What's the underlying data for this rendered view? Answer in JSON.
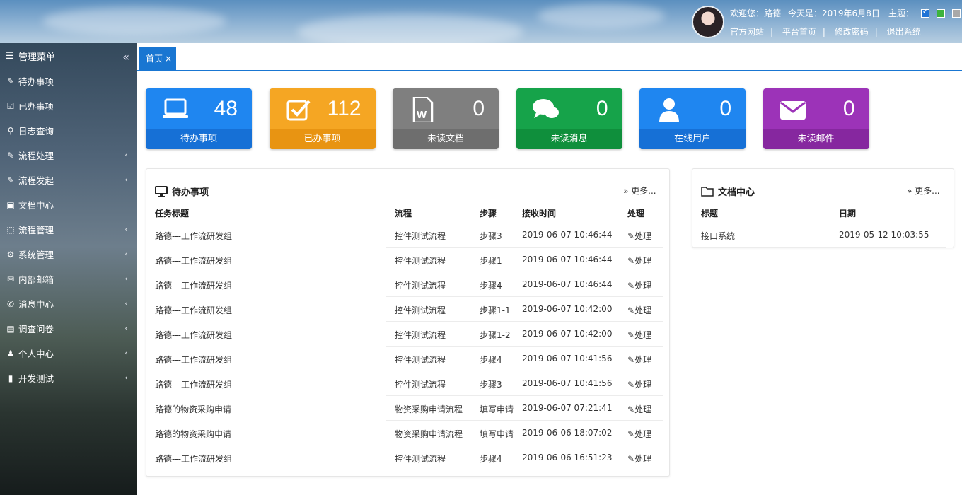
{
  "header": {
    "welcome": "欢迎您：路德",
    "today": "今天是：2019年6月8日",
    "theme_label": "主题：",
    "links": [
      "官方网站",
      "平台首页",
      "修改密码",
      "退出系统"
    ]
  },
  "sidebar": {
    "title": "管理菜单",
    "items": [
      {
        "label": "待办事项",
        "icon": "edit-icon",
        "arrow": false
      },
      {
        "label": "已办事项",
        "icon": "check-square-icon",
        "arrow": false
      },
      {
        "label": "日志查询",
        "icon": "search-icon",
        "arrow": false
      },
      {
        "label": "流程处理",
        "icon": "pencil-square-icon",
        "arrow": true
      },
      {
        "label": "流程发起",
        "icon": "pencil-square-icon",
        "arrow": true
      },
      {
        "label": "文档中心",
        "icon": "briefcase-icon",
        "arrow": false
      },
      {
        "label": "流程管理",
        "icon": "share-square-icon",
        "arrow": true
      },
      {
        "label": "系统管理",
        "icon": "gear-icon",
        "arrow": true
      },
      {
        "label": "内部邮箱",
        "icon": "envelope-icon",
        "arrow": true
      },
      {
        "label": "消息中心",
        "icon": "comments-icon",
        "arrow": true
      },
      {
        "label": "调查问卷",
        "icon": "address-book-icon",
        "arrow": true
      },
      {
        "label": "个人中心",
        "icon": "user-icon",
        "arrow": true
      },
      {
        "label": "开发测试",
        "icon": "bookmark-icon",
        "arrow": true
      }
    ]
  },
  "tabs": [
    {
      "label": "首页",
      "close": "×"
    }
  ],
  "stats": [
    {
      "value": "48",
      "label": "待办事项",
      "icon": "laptop-icon",
      "color": "#1f86f0",
      "bar": "#1670d6"
    },
    {
      "value": "112",
      "label": "已办事项",
      "icon": "check-square-icon",
      "color": "#f5a623",
      "bar": "#e89412"
    },
    {
      "value": "0",
      "label": "未读文档",
      "icon": "word-file-icon",
      "color": "#7f7f7f",
      "bar": "#6e6e6e"
    },
    {
      "value": "0",
      "label": "未读消息",
      "icon": "comments-icon",
      "color": "#16a34a",
      "bar": "#0f8f3c"
    },
    {
      "value": "0",
      "label": "在线用户",
      "icon": "user-icon",
      "color": "#1f86f0",
      "bar": "#1670d6"
    },
    {
      "value": "0",
      "label": "未读邮件",
      "icon": "envelope-icon",
      "color": "#9c33b8",
      "bar": "#86279f"
    }
  ],
  "todo": {
    "title": "待办事项",
    "more": "» 更多...",
    "columns": [
      "任务标题",
      "流程",
      "步骤",
      "接收时间",
      "处理"
    ],
    "action": "处理",
    "rows": [
      [
        "路德---工作流研发组",
        "控件测试流程",
        "步骤3",
        "2019-06-07 10:46:44"
      ],
      [
        "路德---工作流研发组",
        "控件测试流程",
        "步骤1",
        "2019-06-07 10:46:44"
      ],
      [
        "路德---工作流研发组",
        "控件测试流程",
        "步骤4",
        "2019-06-07 10:46:44"
      ],
      [
        "路德---工作流研发组",
        "控件测试流程",
        "步骤1-1",
        "2019-06-07 10:42:00"
      ],
      [
        "路德---工作流研发组",
        "控件测试流程",
        "步骤1-2",
        "2019-06-07 10:42:00"
      ],
      [
        "路德---工作流研发组",
        "控件测试流程",
        "步骤4",
        "2019-06-07 10:41:56"
      ],
      [
        "路德---工作流研发组",
        "控件测试流程",
        "步骤3",
        "2019-06-07 10:41:56"
      ],
      [
        "路德的物资采购申请",
        "物资采购申请流程",
        "填写申请",
        "2019-06-07 07:21:41"
      ],
      [
        "路德的物资采购申请",
        "物资采购申请流程",
        "填写申请",
        "2019-06-06 18:07:02"
      ],
      [
        "路德---工作流研发组",
        "控件测试流程",
        "步骤4",
        "2019-06-06 16:51:23"
      ]
    ]
  },
  "docs": {
    "title": "文档中心",
    "more": "» 更多...",
    "columns": [
      "标题",
      "日期"
    ],
    "rows": [
      [
        "接口系统",
        "2019-05-12 10:03:55"
      ]
    ]
  }
}
